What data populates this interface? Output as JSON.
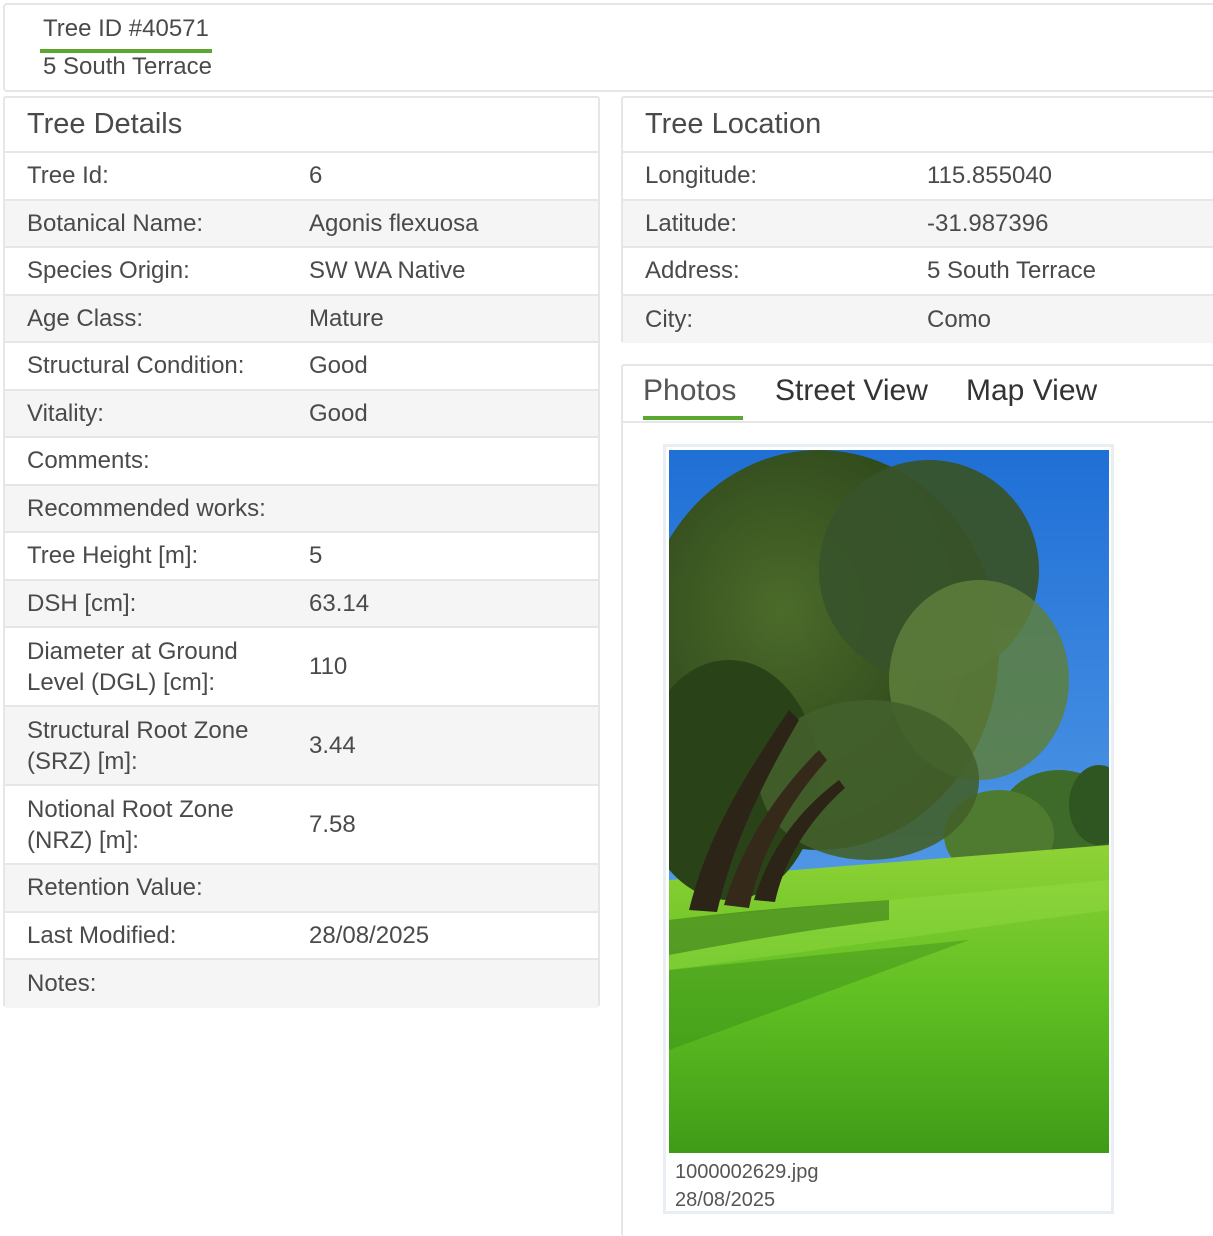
{
  "header": {
    "tree_id": "Tree ID #40571",
    "address": "5 South Terrace"
  },
  "details": {
    "title": "Tree Details",
    "rows": [
      {
        "label": "Tree Id:",
        "value": "6"
      },
      {
        "label": "Botanical Name:",
        "value": "Agonis flexuosa"
      },
      {
        "label": "Species Origin:",
        "value": "SW WA Native"
      },
      {
        "label": "Age Class:",
        "value": "Mature"
      },
      {
        "label": "Structural Condition:",
        "value": "Good"
      },
      {
        "label": "Vitality:",
        "value": "Good"
      },
      {
        "label": "Comments:",
        "value": ""
      },
      {
        "label": "Recommended works:",
        "value": ""
      },
      {
        "label": "Tree Height [m]:",
        "value": "5"
      },
      {
        "label": "DSH [cm]:",
        "value": "63.14"
      },
      {
        "label": "Diameter at Ground Level (DGL) [cm]:",
        "value": "110"
      },
      {
        "label": "Structural Root Zone (SRZ) [m]:",
        "value": "3.44"
      },
      {
        "label": "Notional Root Zone (NRZ) [m]:",
        "value": "7.58"
      },
      {
        "label": "Retention Value:",
        "value": ""
      },
      {
        "label": "Last Modified:",
        "value": "28/08/2025"
      },
      {
        "label": "Notes:",
        "value": ""
      }
    ]
  },
  "location": {
    "title": "Tree Location",
    "rows": [
      {
        "label": "Longitude:",
        "value": "115.855040"
      },
      {
        "label": "Latitude:",
        "value": "-31.987396"
      },
      {
        "label": "Address:",
        "value": "5 South Terrace"
      },
      {
        "label": "City:",
        "value": "Como"
      }
    ]
  },
  "media": {
    "tabs": [
      {
        "label": "Photos",
        "active": true
      },
      {
        "label": "Street View",
        "active": false
      },
      {
        "label": "Map View",
        "active": false
      }
    ],
    "photo": {
      "filename": "1000002629.jpg",
      "date": "28/08/2025"
    }
  },
  "colors": {
    "accent": "#5aa832",
    "border": "#e6e6e6",
    "row_alt": "#f5f5f5",
    "text": "#4a4a4a"
  }
}
